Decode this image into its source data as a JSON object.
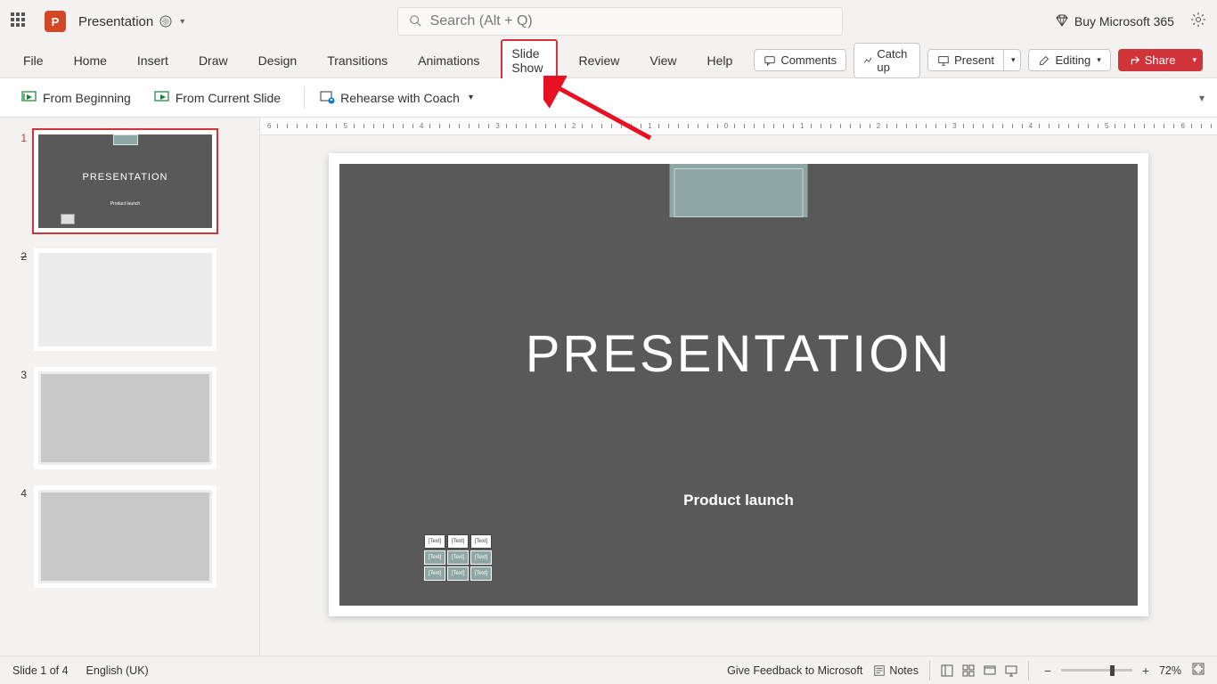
{
  "titlebar": {
    "doc_name": "Presentation",
    "search_placeholder": "Search (Alt + Q)",
    "buy_label": "Buy Microsoft 365"
  },
  "tabs": {
    "file": "File",
    "home": "Home",
    "insert": "Insert",
    "draw": "Draw",
    "design": "Design",
    "transitions": "Transitions",
    "animations": "Animations",
    "slideshow": "Slide Show",
    "review": "Review",
    "view": "View",
    "help": "Help"
  },
  "ribbon_right": {
    "comments": "Comments",
    "catchup": "Catch up",
    "present": "Present",
    "editing": "Editing",
    "share": "Share"
  },
  "ribbon_content": {
    "from_beginning": "From Beginning",
    "from_current": "From Current Slide",
    "rehearse": "Rehearse with Coach"
  },
  "thumbnails": {
    "slide1": {
      "num": "1",
      "title": "PRESENTATION",
      "sub": "Product launch"
    },
    "slide2": {
      "num": "2"
    },
    "slide3": {
      "num": "3"
    },
    "slide4": {
      "num": "4"
    }
  },
  "slide": {
    "title": "PRESENTATION",
    "subtitle": "Product launch",
    "cell": "[Text]"
  },
  "statusbar": {
    "slide_info": "Slide 1 of 4",
    "language": "English (UK)",
    "feedback": "Give Feedback to Microsoft",
    "notes": "Notes",
    "zoom": "72%"
  },
  "ruler_labels": [
    "6",
    "5",
    "4",
    "3",
    "2",
    "1",
    "0",
    "1",
    "2",
    "3",
    "4",
    "5",
    "6"
  ]
}
